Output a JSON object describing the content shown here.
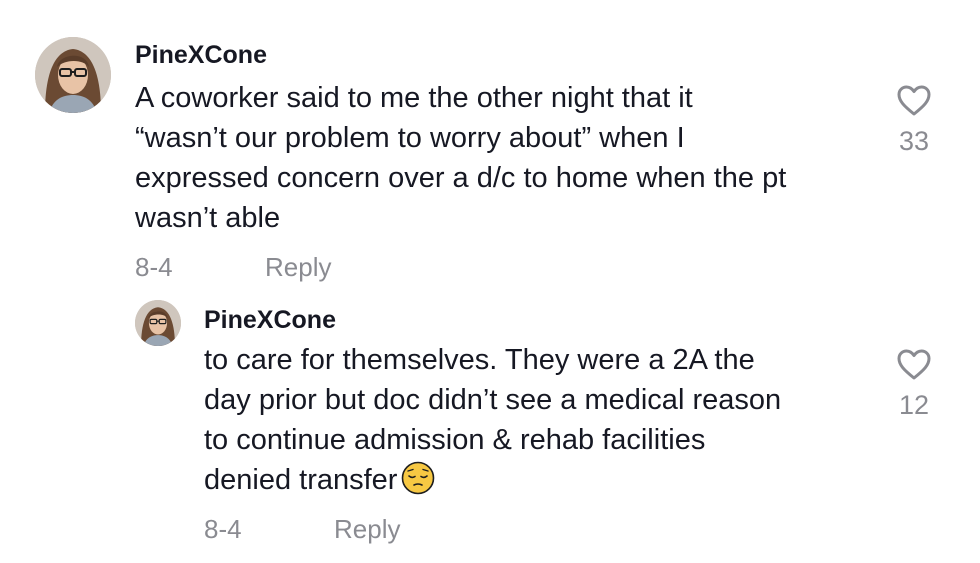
{
  "comments": [
    {
      "username": "PineXCone",
      "lines": [
        "A coworker said to me the other night that it",
        "“wasn’t our problem to worry about” when I",
        "expressed concern over a d/c to home when the pt",
        "wasn’t able"
      ],
      "date": "8-4",
      "reply_label": "Reply",
      "like_count": "33",
      "avatar_icon": "user-avatar-icon",
      "like_icon": "heart-outline-icon"
    },
    {
      "username": "PineXCone",
      "lines": [
        "to care for themselves. They were a 2A the",
        "day prior but doc didn’t see a medical reason",
        "to continue admission & rehab facilities",
        "denied transfer"
      ],
      "emoji": "pensive-face-emoji",
      "date": "8-4",
      "reply_label": "Reply",
      "like_count": "12",
      "avatar_icon": "user-avatar-icon",
      "like_icon": "heart-outline-icon"
    }
  ],
  "colors": {
    "text": "#161823",
    "secondary": "#8a8b91",
    "background": "#ffffff"
  }
}
